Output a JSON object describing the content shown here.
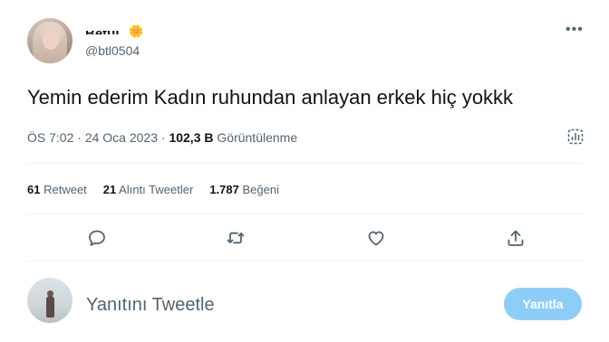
{
  "user": {
    "display_name": "Betül",
    "name_emoji": "🌼",
    "handle": "@btl0504"
  },
  "tweet": {
    "text": "Yemin ederim Kadın ruhundan anlayan erkek hiç yokkk",
    "time": "ÖS 7:02",
    "separator": "·",
    "date": "24 Oca 2023",
    "views_count": "102,3 B",
    "views_label": "Görüntülenme"
  },
  "stats": {
    "retweets_count": "61",
    "retweets_label": "Retweet",
    "quotes_count": "21",
    "quotes_label": "Alıntı Tweetler",
    "likes_count": "1.787",
    "likes_label": "Beğeni"
  },
  "reply": {
    "placeholder": "Yanıtını Tweetle",
    "button_label": "Yanıtla"
  },
  "icons": {
    "more": "more-icon",
    "analytics": "analytics-icon",
    "reply": "reply-icon",
    "retweet": "retweet-icon",
    "like": "heart-icon",
    "share": "share-icon"
  },
  "colors": {
    "text": "#0f1419",
    "secondary": "#536471",
    "divider": "#eff3f4",
    "reply_button": "#8ecdf8"
  }
}
